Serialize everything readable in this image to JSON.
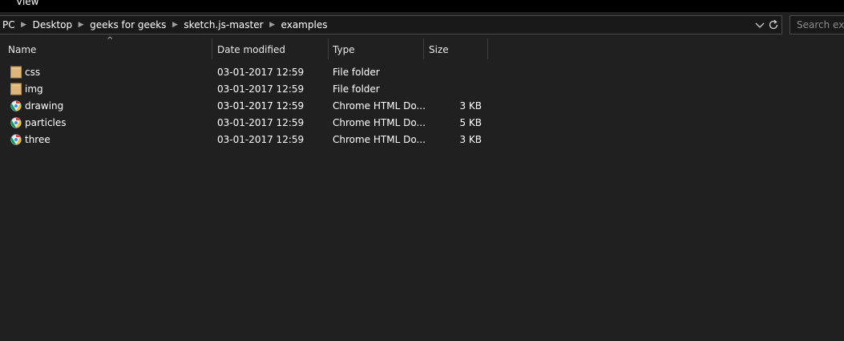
{
  "ribbon": {
    "tab_label": "View"
  },
  "address": {
    "crumbs": [
      "PC",
      "Desktop",
      "geeks for geeks",
      "sketch.js-master",
      "examples"
    ]
  },
  "search": {
    "placeholder": "Search examples"
  },
  "columns": {
    "name": "Name",
    "date": "Date modified",
    "type": "Type",
    "size": "Size"
  },
  "files": [
    {
      "name": "css",
      "date": "03-01-2017 12:59",
      "type": "File folder",
      "size": "",
      "icon": "folder-icon"
    },
    {
      "name": "img",
      "date": "03-01-2017 12:59",
      "type": "File folder",
      "size": "",
      "icon": "folder-icon"
    },
    {
      "name": "drawing",
      "date": "03-01-2017 12:59",
      "type": "Chrome HTML Do...",
      "size": "3 KB",
      "icon": "chrome-html-icon"
    },
    {
      "name": "particles",
      "date": "03-01-2017 12:59",
      "type": "Chrome HTML Do...",
      "size": "5 KB",
      "icon": "chrome-html-icon"
    },
    {
      "name": "three",
      "date": "03-01-2017 12:59",
      "type": "Chrome HTML Do...",
      "size": "3 KB",
      "icon": "chrome-html-icon"
    }
  ],
  "colors": {
    "background": "#202020",
    "ribbon": "#000000",
    "folder": "#dcb67a",
    "text": "#ffffff"
  }
}
